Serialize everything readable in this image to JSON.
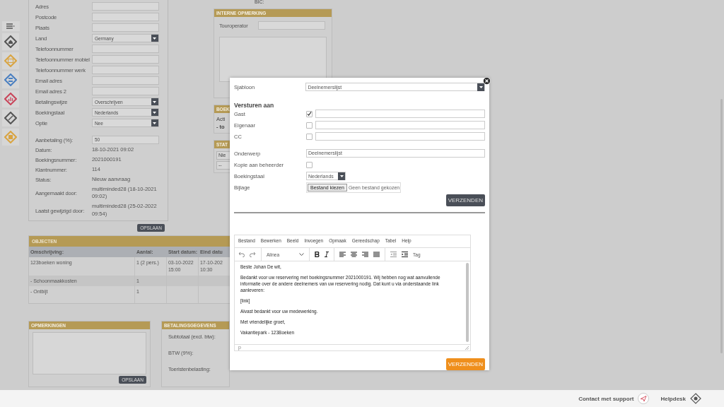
{
  "sidebar": {
    "items": [
      {
        "kind": "menu"
      },
      {
        "kind": "home",
        "color": "#555555"
      },
      {
        "kind": "card",
        "color": "#d9a441"
      },
      {
        "kind": "list",
        "color": "#4a7fc1"
      },
      {
        "kind": "chart",
        "color": "#c9455a"
      },
      {
        "kind": "link",
        "color": "#555555"
      },
      {
        "kind": "note",
        "color": "#d9a441"
      }
    ]
  },
  "guest_form": {
    "fields": [
      {
        "label": "Adres",
        "kind": "input"
      },
      {
        "label": "Postcode",
        "kind": "input"
      },
      {
        "label": "Plaats",
        "kind": "input"
      },
      {
        "label": "Land",
        "kind": "select",
        "value": "Germany"
      },
      {
        "label": "Telefoonnummer",
        "kind": "input"
      },
      {
        "label": "Telefoonnummer mobiel",
        "kind": "input"
      },
      {
        "label": "Telefoonnummer werk",
        "kind": "input"
      },
      {
        "label": "Email adres",
        "kind": "input"
      },
      {
        "label": "Email adres 2",
        "kind": "input"
      },
      {
        "label": "Betalingswijze",
        "kind": "select",
        "value": "Overschrijven"
      },
      {
        "label": "Boekingstaal",
        "kind": "select",
        "value": "Nederlands"
      },
      {
        "label": "Optie",
        "kind": "select",
        "value": "Nee"
      }
    ],
    "payment_percent": {
      "label": "Aanbetaling (%):",
      "value": "50"
    },
    "info": [
      {
        "label": "Datum:",
        "value": "18-10-2021 09:02"
      },
      {
        "label": "Boekingsnummer:",
        "value": "2021000191"
      },
      {
        "label": "Klantnummer:",
        "value": "114"
      },
      {
        "label": "Status:",
        "value": "Nieuw aanvraag"
      },
      {
        "label": "Aangemaakt door:",
        "value": "multiminded28 (18-10-2021 09:02)"
      },
      {
        "label": "Laatst gewijzigd door:",
        "value": "multiminded28 (25-02-2022 09:54)"
      }
    ],
    "save_button": "OPSLAAN"
  },
  "bic_label": "BIC:",
  "internal_note": {
    "title": "INTERNE OPMERKING",
    "touroperator_label": "Touroperator"
  },
  "booking_panel": {
    "title": "BOEK",
    "lines": [
      "Acti",
      "- to"
    ]
  },
  "status_panel": {
    "title": "STAT",
    "selects": [
      "Nie",
      "--"
    ]
  },
  "objects": {
    "title": "OBJECTEN",
    "columns": [
      "Omschrijving:",
      "Aantal:",
      "Start datum:",
      "Eind datu"
    ],
    "rows": [
      {
        "cells": [
          "123boeken woning",
          "1 (2 pers.)",
          "03-10-2022 15:00",
          "17-10-202 10:30"
        ]
      },
      {
        "cells": [
          "- Schoonmaakkosten",
          "1"
        ]
      },
      {
        "cells": [
          "- Ontbijt",
          "1"
        ]
      }
    ]
  },
  "remarks": {
    "title": "OPMERKINGEN",
    "save_button": "OPSLAAN"
  },
  "payment": {
    "title": "BETALINGSGEGEVENS",
    "lines": [
      "Subtotaal (excl. btw):",
      "BTW (9%):",
      "Toeristenbelasting:"
    ]
  },
  "modal": {
    "template": {
      "label": "Sjabloon",
      "value": "Deelnemerslijst"
    },
    "send_to_heading": "Versturen aan",
    "recipients": [
      {
        "label": "Gast",
        "checked": true
      },
      {
        "label": "Eigenaar",
        "checked": false
      },
      {
        "label": "CC",
        "checked": false
      }
    ],
    "subject": {
      "label": "Onderwerp",
      "value": "Deelnemerslijst"
    },
    "copy_admin": {
      "label": "Kopie aan beheerder",
      "checked": false
    },
    "language": {
      "label": "Boekingstaal",
      "value": "Nederlands"
    },
    "attachment": {
      "label": "Bijlage",
      "button": "Bestand kiezen",
      "status": "Geen bestand gekozen"
    },
    "send_button": "VERZENDEN",
    "editor": {
      "menu": [
        "Bestand",
        "Bewerken",
        "Beeld",
        "Invoegen",
        "Opmaak",
        "Gereedschap",
        "Tabel",
        "Help"
      ],
      "block_format": "Alinea",
      "tag_button": "Tag",
      "paragraphs": [
        "Beste Johan De wit,",
        "Bedankt voor uw reservering met boekingsnummer 2021000191. Wij hebben nog wat aanvullende informatie over de andere deelnemers van uw reservering nodig. Dat kunt u via onderstaande link aanleveren:",
        "[link]",
        "Alvast bedankt voor uw medewerking.",
        "Met vriendelijke groet,",
        "Vakantiepark - 123Boeken"
      ],
      "status_path": "p"
    },
    "send_button_2": "VERZENDEN"
  },
  "footer": {
    "support": "Contact met support",
    "helpdesk": "Helpdesk"
  }
}
